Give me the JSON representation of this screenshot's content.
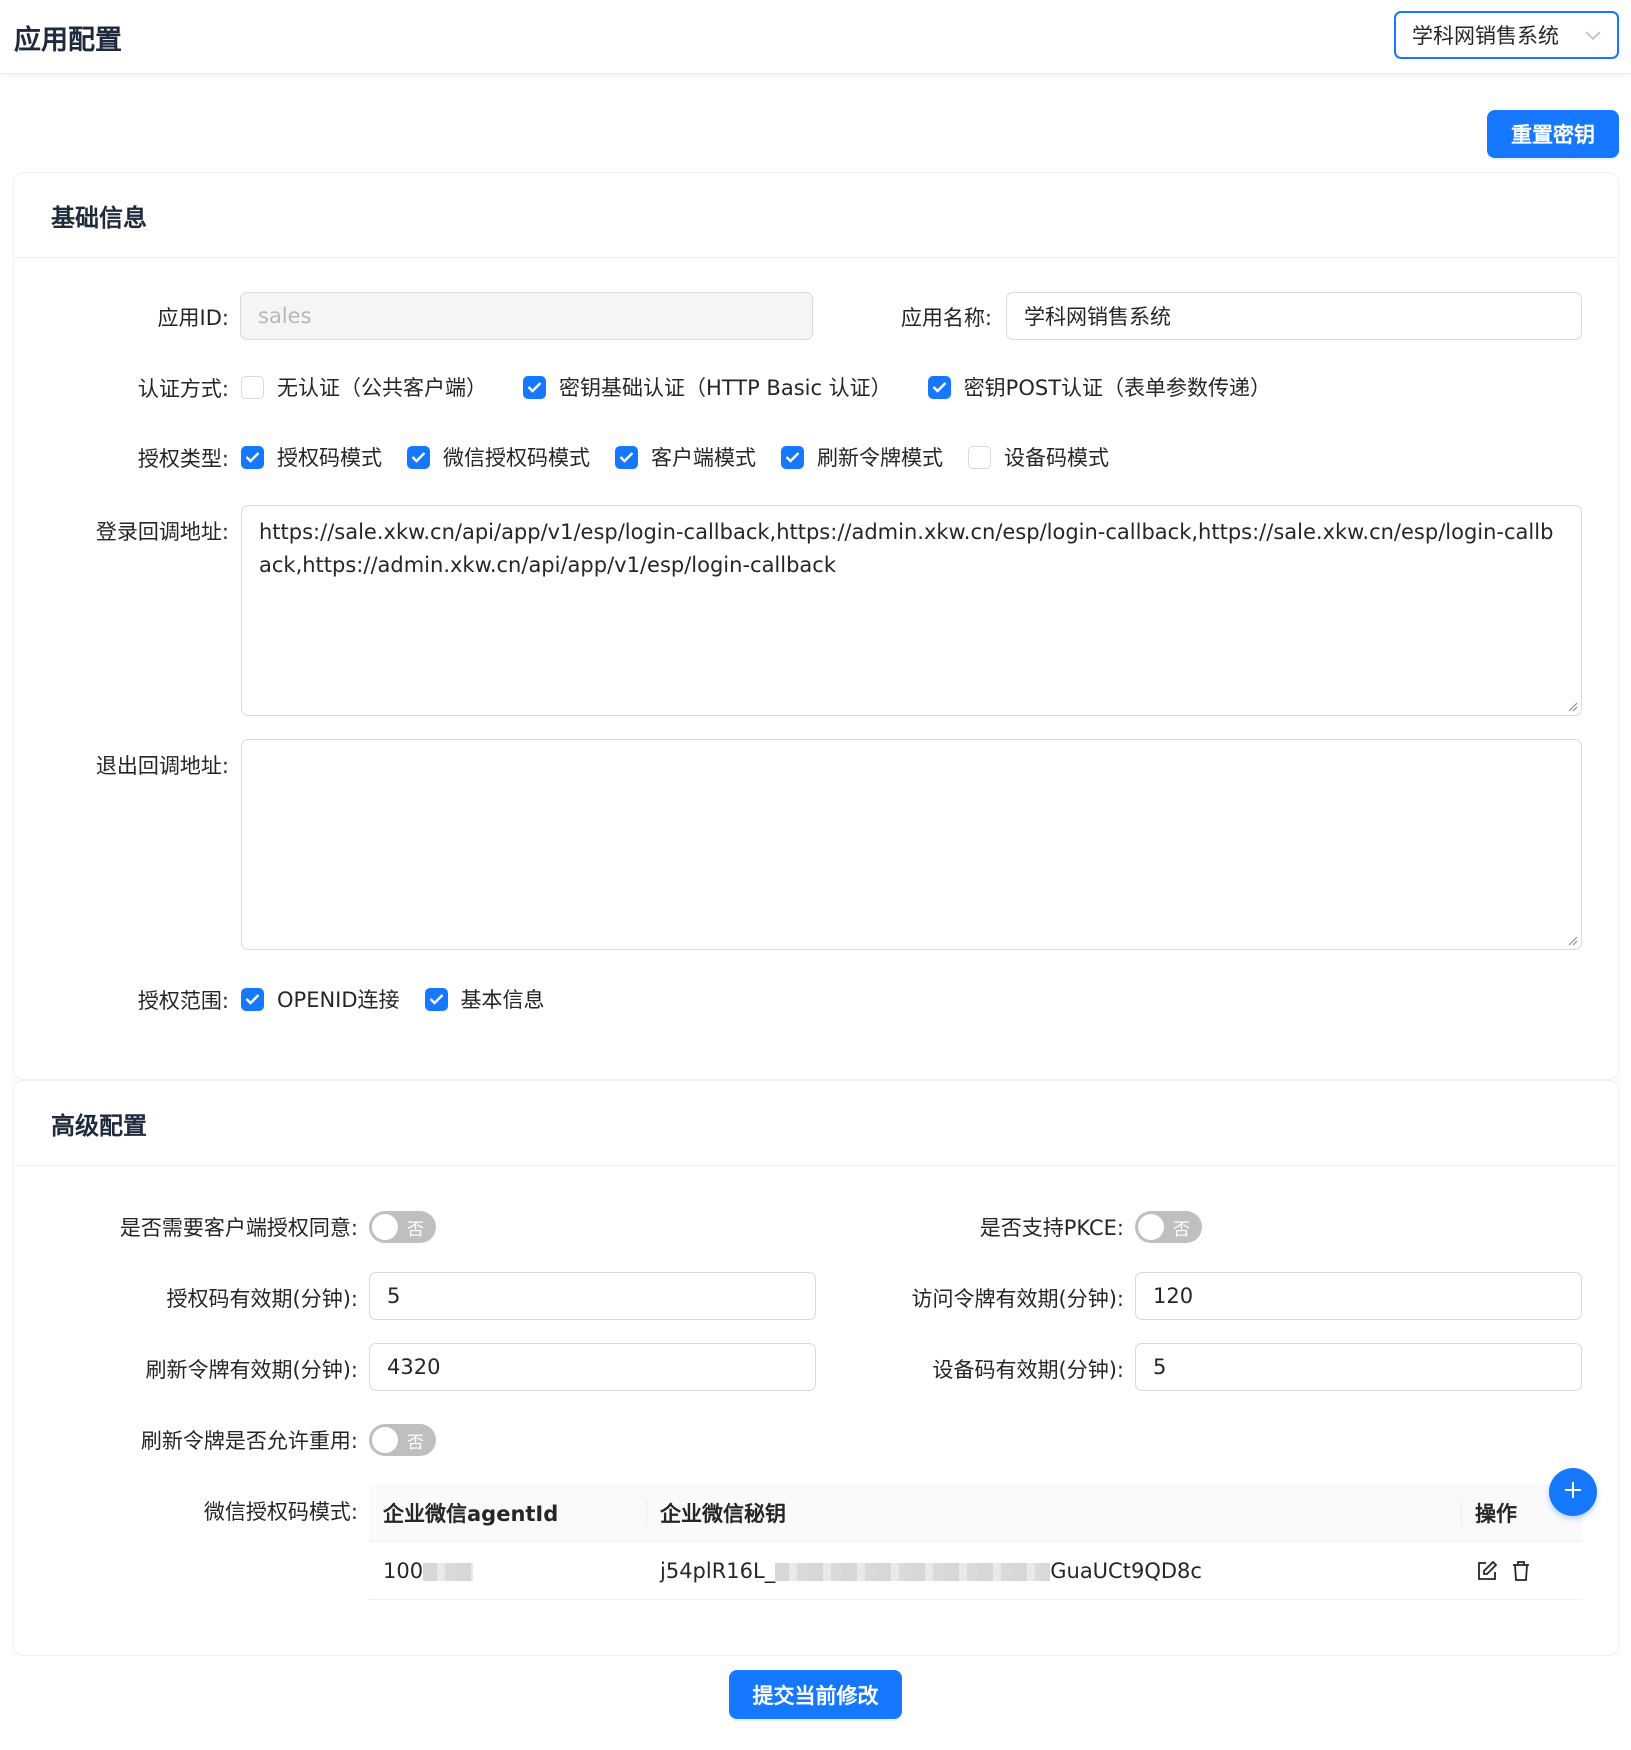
{
  "header": {
    "title": "应用配置",
    "app_selector": {
      "value": "学科网销售系统"
    }
  },
  "actions": {
    "reset_secret": "重置密钥",
    "submit": "提交当前修改"
  },
  "basic": {
    "section_title": "基础信息",
    "app_id": {
      "label": "应用ID:",
      "value": "sales"
    },
    "app_name": {
      "label": "应用名称:",
      "value": "学科网销售系统"
    },
    "auth_method": {
      "label": "认证方式:",
      "options": [
        {
          "label": "无认证（公共客户端）",
          "checked": false
        },
        {
          "label": "密钥基础认证（HTTP Basic 认证）",
          "checked": true
        },
        {
          "label": "密钥POST认证（表单参数传递）",
          "checked": true
        }
      ]
    },
    "grant_types": {
      "label": "授权类型:",
      "options": [
        {
          "label": "授权码模式",
          "checked": true
        },
        {
          "label": "微信授权码模式",
          "checked": true
        },
        {
          "label": "客户端模式",
          "checked": true
        },
        {
          "label": "刷新令牌模式",
          "checked": true
        },
        {
          "label": "设备码模式",
          "checked": false
        }
      ]
    },
    "login_callback": {
      "label": "登录回调地址:",
      "value": "https://sale.xkw.cn/api/app/v1/esp/login-callback,https://admin.xkw.cn/esp/login-callback,https://sale.xkw.cn/esp/login-callback,https://admin.xkw.cn/api/app/v1/esp/login-callback"
    },
    "logout_callback": {
      "label": "退出回调地址:",
      "value": ""
    },
    "scopes": {
      "label": "授权范围:",
      "options": [
        {
          "label": "OPENID连接",
          "checked": true
        },
        {
          "label": "基本信息",
          "checked": true
        }
      ]
    }
  },
  "advanced": {
    "section_title": "高级配置",
    "require_consent": {
      "label": "是否需要客户端授权同意:",
      "state": "否"
    },
    "support_pkce": {
      "label": "是否支持PKCE:",
      "state": "否"
    },
    "auth_code_ttl": {
      "label": "授权码有效期(分钟):",
      "value": "5"
    },
    "access_token_ttl": {
      "label": "访问令牌有效期(分钟):",
      "value": "120"
    },
    "refresh_token_ttl": {
      "label": "刷新令牌有效期(分钟):",
      "value": "4320"
    },
    "device_code_ttl": {
      "label": "设备码有效期(分钟):",
      "value": "5"
    },
    "refresh_reuse": {
      "label": "刷新令牌是否允许重用:",
      "state": "否"
    },
    "wechat": {
      "label": "微信授权码模式:",
      "columns": [
        "企业微信agentId",
        "企业微信秘钥",
        "操作"
      ],
      "rows": [
        {
          "agent_id_visible": "100",
          "secret_prefix": "j54plR16L_",
          "secret_suffix": "GuaUCt9QD8c"
        }
      ]
    }
  },
  "colors": {
    "primary": "#1677ff",
    "border": "#d9d9d9",
    "switch_off": "#bfbfbf"
  },
  "icons": [
    "chevron-down-icon",
    "check-icon",
    "plus-icon",
    "edit-icon",
    "delete-icon"
  ]
}
